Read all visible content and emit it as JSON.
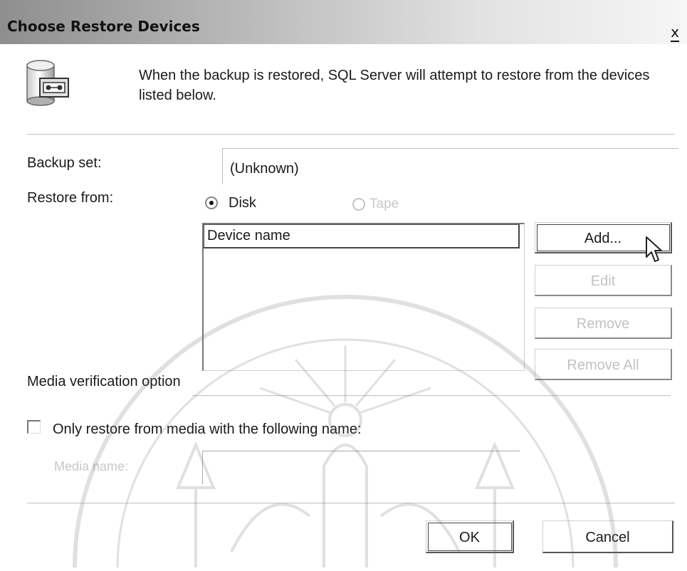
{
  "dialog": {
    "title": "Choose Restore Devices",
    "close_glyph": "x",
    "intro": "When the backup is restored, SQL Server will attempt to restore from the devices listed below."
  },
  "form": {
    "backup_set_label": "Backup set:",
    "backup_set_value": "(Unknown)",
    "restore_from_label": "Restore from:",
    "radio_disk": {
      "label": "Disk",
      "selected": true
    },
    "radio_tape": {
      "label": "Tape",
      "selected": false,
      "enabled": false
    },
    "device_list": {
      "header": "Device name",
      "items": []
    },
    "buttons": {
      "add": "Add...",
      "edit": "Edit",
      "remove": "Remove",
      "remove_all": "Remove All"
    },
    "media_verification_label": "Media verification option",
    "only_restore_checkbox": {
      "label": "Only restore from media with the following name:",
      "checked": false
    },
    "media_name_label": "Media name:",
    "media_name_value": ""
  },
  "footer": {
    "ok": "OK",
    "cancel": "Cancel"
  },
  "icons": {
    "dialog_icon": "database-tape-icon",
    "cursor": "mouse-pointer-icon",
    "watermark": "university-seal-watermark"
  }
}
